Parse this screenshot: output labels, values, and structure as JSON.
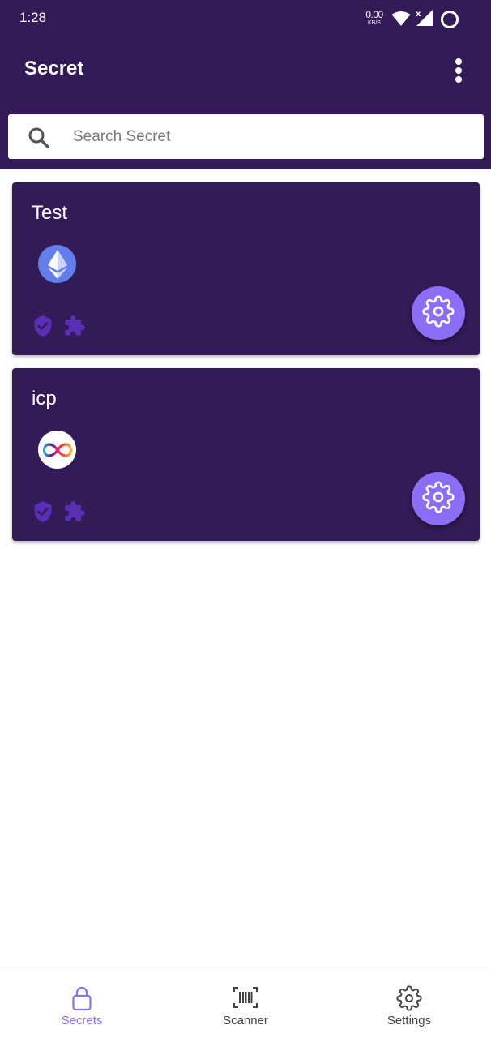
{
  "status_bar": {
    "time": "1:28",
    "net_speed_value": "0.00",
    "net_speed_unit": "KB/S",
    "signal_badge": "x"
  },
  "app_bar": {
    "title": "Secret",
    "menu_icon": "more-vert-icon"
  },
  "search": {
    "placeholder": "Search Secret",
    "value": "",
    "icon": "search-icon"
  },
  "secrets": [
    {
      "title": "Test",
      "coin_icon": "ethereum-icon",
      "status_icons": [
        "shield-check-icon",
        "puzzle-icon"
      ],
      "action_icon": "gear-icon"
    },
    {
      "title": "icp",
      "coin_icon": "icp-infinity-icon",
      "status_icons": [
        "shield-check-icon",
        "puzzle-icon"
      ],
      "action_icon": "gear-icon"
    }
  ],
  "bottom_nav": {
    "items": [
      {
        "label": "Secrets",
        "icon": "lock-icon",
        "active": true
      },
      {
        "label": "Scanner",
        "icon": "barcode-scanner-icon",
        "active": false
      },
      {
        "label": "Settings",
        "icon": "gear-icon",
        "active": false
      }
    ]
  },
  "colors": {
    "primary": "#321b56",
    "accent": "#8b6ef5",
    "status_icon": "#5a2fb5",
    "background": "#ffffff",
    "ethereum": "#627eea"
  }
}
